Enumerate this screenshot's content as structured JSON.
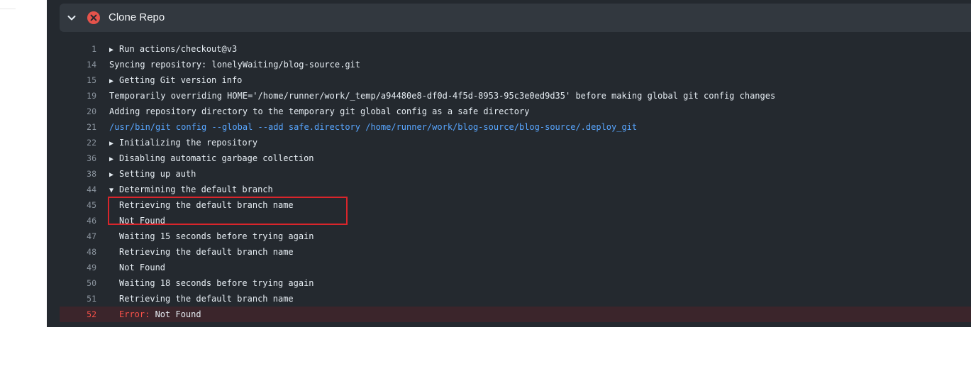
{
  "step": {
    "title": "Clone Repo",
    "status_icon": "x-circle-fail-icon",
    "status_color": "#e5534b",
    "toggle_icon": "chevron-down-icon"
  },
  "log": {
    "lines": [
      {
        "num": "1",
        "text": "Run actions/checkout@v3",
        "toggle": "▶"
      },
      {
        "num": "14",
        "text": "Syncing repository: lonelyWaiting/blog-source.git"
      },
      {
        "num": "15",
        "text": "Getting Git version info",
        "toggle": "▶"
      },
      {
        "num": "19",
        "text": "Temporarily overriding HOME='/home/runner/work/_temp/a94480e8-df0d-4f5d-8953-95c3e0ed9d35' before making global git config changes"
      },
      {
        "num": "20",
        "text": "Adding repository directory to the temporary git global config as a safe directory"
      },
      {
        "num": "21",
        "text": "/usr/bin/git config --global --add safe.directory /home/runner/work/blog-source/blog-source/.deploy_git"
      },
      {
        "num": "22",
        "text": "Initializing the repository",
        "toggle": "▶"
      },
      {
        "num": "36",
        "text": "Disabling automatic garbage collection",
        "toggle": "▶"
      },
      {
        "num": "38",
        "text": "Setting up auth",
        "toggle": "▶"
      },
      {
        "num": "44",
        "text": "Determining the default branch",
        "toggle": "▼"
      },
      {
        "num": "45",
        "text": "Retrieving the default branch name"
      },
      {
        "num": "46",
        "text": "Not Found"
      },
      {
        "num": "47",
        "text": "Waiting 15 seconds before trying again"
      },
      {
        "num": "48",
        "text": "Retrieving the default branch name"
      },
      {
        "num": "49",
        "text": "Not Found"
      },
      {
        "num": "50",
        "text": "Waiting 18 seconds before trying again"
      },
      {
        "num": "51",
        "text": "Retrieving the default branch name"
      },
      {
        "num": "52",
        "error_label": "Error:",
        "text": " Not Found"
      }
    ]
  },
  "colors": {
    "panel_bg": "#24292f",
    "header_bg": "#32383f",
    "command_text": "#58a6ff",
    "error_text": "#f85149",
    "error_row_bg": "#3b252b",
    "annotation_box": "#d9252b"
  }
}
